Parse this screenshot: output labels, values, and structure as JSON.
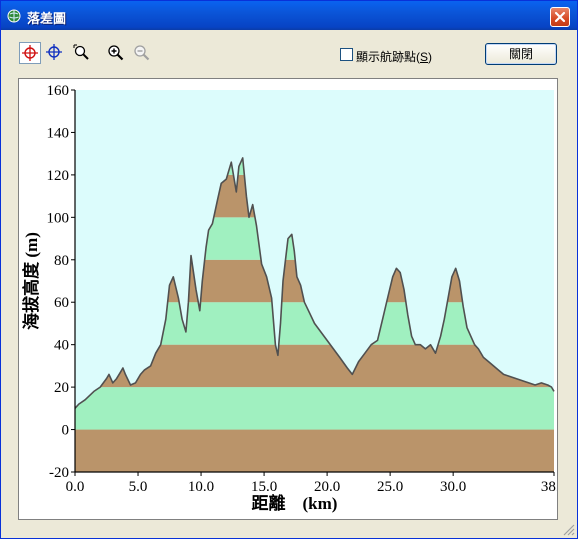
{
  "window": {
    "title": "落差圖",
    "close_icon": "close-icon",
    "app_icon": "globe-icon"
  },
  "toolbar": {
    "tools": [
      {
        "name": "crosshair-red-icon",
        "active": true
      },
      {
        "name": "crosshair-blue-icon",
        "active": false
      },
      {
        "name": "zoom-select-icon",
        "active": false
      },
      {
        "name": "zoom-in-icon",
        "active": false
      },
      {
        "name": "zoom-out-icon",
        "active": false,
        "disabled": true
      }
    ],
    "show_points_label": "顯示航跡點(",
    "show_points_key": "S",
    "show_points_suffix": ")",
    "show_points_checked": false,
    "close_button_label": "關閉"
  },
  "colors": {
    "plot_bg": "#dcfcfc",
    "band_brown": "#ba946a",
    "band_green": "#a0f0c0",
    "profile_line": "#505050"
  },
  "chart_data": {
    "type": "area",
    "title": "",
    "xlabel": "距離　(km)",
    "ylabel": "海拔高度 (m)",
    "xlim": [
      0.0,
      38.0
    ],
    "ylim": [
      -20,
      160
    ],
    "xticks": [
      "0.0",
      "5.0",
      "10.0",
      "15.0",
      "20.0",
      "25.0",
      "30.0",
      "38.0"
    ],
    "yticks": [
      "160",
      "140",
      "120",
      "100",
      "80",
      "60",
      "40",
      "20",
      "0",
      "-20"
    ],
    "grid": false,
    "band_height": 20,
    "series": [
      {
        "x": [
          0.0,
          0.3,
          0.8,
          1.5,
          2.0,
          2.5,
          2.7,
          3.0,
          3.3,
          3.6,
          3.8,
          4.0,
          4.4,
          4.8,
          5.2,
          5.5,
          6.0,
          6.4,
          6.8,
          7.2,
          7.5,
          7.8,
          8.2,
          8.5,
          8.8,
          9.0,
          9.2,
          9.6,
          9.9,
          10.1,
          10.4,
          10.6,
          10.9,
          11.3,
          11.6,
          12.0,
          12.4,
          12.8,
          13.0,
          13.3,
          13.6,
          13.8,
          14.1,
          14.4,
          14.8,
          15.2,
          15.6,
          15.9,
          16.1,
          16.3,
          16.5,
          16.9,
          17.2,
          17.4,
          17.6,
          17.9,
          18.2,
          18.6,
          19.0,
          19.5,
          20.0,
          20.5,
          21.0,
          21.6,
          22.0,
          22.5,
          23.0,
          23.5,
          24.0,
          24.4,
          24.8,
          25.2,
          25.5,
          25.8,
          26.1,
          26.4,
          26.7,
          27.0,
          27.4,
          27.8,
          28.2,
          28.6,
          29.0,
          29.3,
          29.6,
          29.9,
          30.2,
          30.5,
          30.8,
          31.1,
          31.4,
          31.7,
          32.0,
          32.4,
          32.8,
          33.2,
          33.6,
          34.0,
          34.5,
          35.0,
          35.5,
          36.0,
          36.5,
          37.0,
          37.5,
          37.8,
          38.0
        ],
        "y": [
          10,
          12,
          14,
          18,
          20,
          24,
          26,
          22,
          24,
          27,
          29,
          26,
          21,
          22,
          26,
          28,
          30,
          36,
          40,
          52,
          68,
          72,
          62,
          52,
          46,
          60,
          82,
          66,
          56,
          70,
          86,
          94,
          97,
          108,
          116,
          118,
          126,
          112,
          124,
          128,
          110,
          100,
          106,
          96,
          78,
          72,
          62,
          40,
          35,
          50,
          70,
          90,
          92,
          84,
          72,
          68,
          60,
          55,
          50,
          46,
          42,
          38,
          34,
          29,
          26,
          32,
          36,
          40,
          42,
          52,
          62,
          72,
          76,
          74,
          66,
          54,
          44,
          40,
          40,
          38,
          40,
          36,
          44,
          52,
          62,
          72,
          76,
          70,
          58,
          48,
          44,
          40,
          38,
          34,
          32,
          30,
          28,
          26,
          25,
          24,
          23,
          22,
          21,
          22,
          21,
          20,
          18
        ]
      }
    ]
  }
}
